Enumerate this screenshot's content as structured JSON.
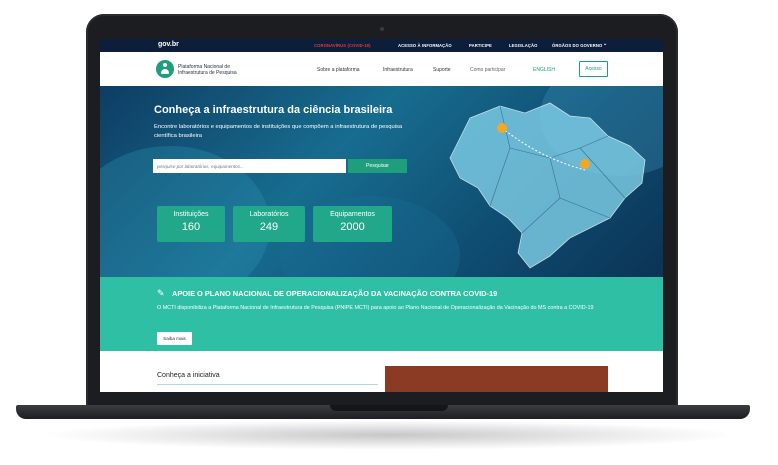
{
  "govbar": {
    "logo": "gov.br",
    "links": [
      "CORONAVÍRUS (COVID-19)",
      "ACESSO À INFORMAÇÃO",
      "PARTICIPE",
      "LEGISLAÇÃO",
      "ÓRGÃOS DO GOVERNO"
    ]
  },
  "header": {
    "brand_line1": "Plataforma Nacional de",
    "brand_line2": "Infraestrutura de Pesquisa",
    "nav": [
      "Sobre a plataforma",
      "Infraestrutura",
      "Suporte",
      "Como participar",
      "ENGLISH"
    ],
    "login": "Acesso"
  },
  "hero": {
    "title": "Conheça a infraestrutura da ciência brasileira",
    "subtitle": "Encontre laboratórios e equipamentos de instituições que compõem a infraestrutura de pesquisa científica brasileira",
    "search_placeholder": "pesquise por laboratórios, equipamentos...",
    "search_button": "Pesquisar",
    "stats": [
      {
        "label": "Instituições",
        "value": "160"
      },
      {
        "label": "Laboratórios",
        "value": "249"
      },
      {
        "label": "Equipamentos",
        "value": "2000"
      }
    ]
  },
  "band": {
    "title": "APOIE O PLANO NACIONAL DE OPERACIONALIZAÇÃO DA VACINAÇÃO CONTRA COVID-19",
    "text": "O MCTI disponibiliza a Plataforma Nacional de Infraestrutura de Pesquisa (PNIPE MCTI) para apoio ao Plano Nacional de Operacionalização da Vacinação do MS contra a COVID-19",
    "button": "Saiba mais"
  },
  "section": {
    "heading": "Conheça a iniciativa"
  },
  "colors": {
    "green": "#1e9e7d",
    "teal_band": "#2ebfa5",
    "govbar": "#0d1e3a",
    "covid_red": "#e53935"
  }
}
